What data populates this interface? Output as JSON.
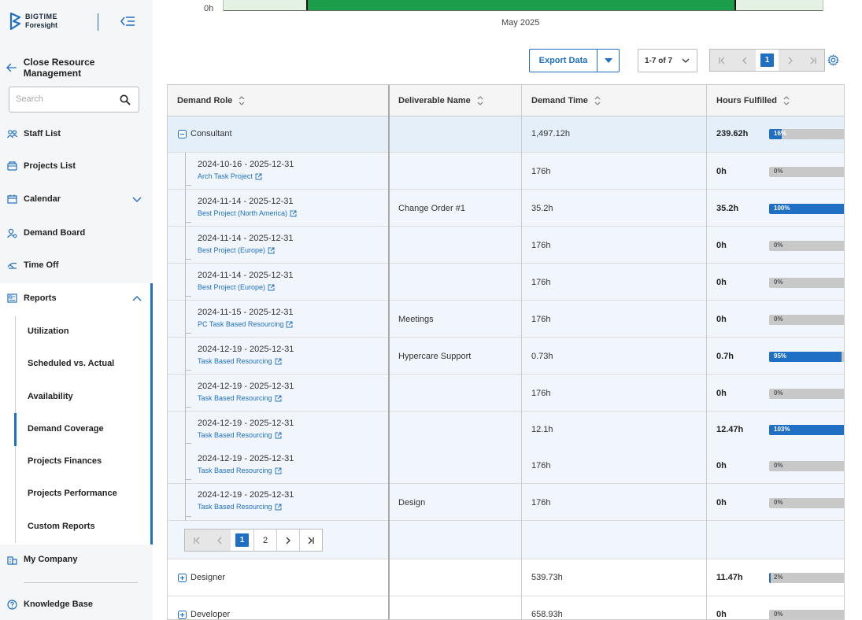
{
  "logo": {
    "line1": "BIGTIME",
    "line2": "Foresight"
  },
  "sidebar": {
    "close_label": "Close Resource Management",
    "search_placeholder": "Search",
    "items": [
      {
        "label": "Staff List",
        "icon": "users-icon"
      },
      {
        "label": "Projects List",
        "icon": "folder-icon"
      },
      {
        "label": "Calendar",
        "icon": "calendar-icon"
      },
      {
        "label": "Demand Board",
        "icon": "person-search-icon"
      },
      {
        "label": "Time Off",
        "icon": "plane-icon"
      },
      {
        "label": "Reports",
        "icon": "report-icon"
      },
      {
        "label": "My Company",
        "icon": "building-icon"
      },
      {
        "label": "Knowledge Base",
        "icon": "help-icon"
      }
    ],
    "report_items": [
      "Utilization",
      "Scheduled vs. Actual",
      "Availability",
      "Demand Coverage",
      "Projects Finances",
      "Projects Performance",
      "Custom Reports"
    ],
    "active_report": "Demand Coverage"
  },
  "chart": {
    "zero_label": "0h",
    "month_label": "May 2025",
    "bar_color": "#1a9e4a"
  },
  "toolbar": {
    "export_label": "Export Data",
    "page_size_label": "1-7 of 7",
    "current_page": "1"
  },
  "table": {
    "headers": [
      "Demand Role",
      "Deliverable Name",
      "Demand Time",
      "Hours Fulfilled"
    ],
    "group": {
      "role": "Consultant",
      "demand": "1,497.12h",
      "fulfilled": "239.62h",
      "pct_label": "16%",
      "pct": 16
    },
    "rows": [
      {
        "dates": "2024-10-16 - 2025-12-31",
        "project": "Arch Task Project",
        "deliverable": "",
        "demand": "176h",
        "fulfilled": "0h",
        "pct_label": "0%",
        "pct": 0
      },
      {
        "dates": "2024-11-14 - 2025-12-31",
        "project": "Best Project (North America)",
        "deliverable": "Change Order #1",
        "demand": "35.2h",
        "fulfilled": "35.2h",
        "pct_label": "100%",
        "pct": 100
      },
      {
        "dates": "2024-11-14 - 2025-12-31",
        "project": "Best Project (Europe)",
        "deliverable": "",
        "demand": "176h",
        "fulfilled": "0h",
        "pct_label": "0%",
        "pct": 0
      },
      {
        "dates": "2024-11-14 - 2025-12-31",
        "project": "Best Project (Europe)",
        "deliverable": "",
        "demand": "176h",
        "fulfilled": "0h",
        "pct_label": "0%",
        "pct": 0
      },
      {
        "dates": "2024-11-15 - 2025-12-31",
        "project": "PC Task Based Resourcing",
        "deliverable": "Meetings",
        "demand": "176h",
        "fulfilled": "0h",
        "pct_label": "0%",
        "pct": 0
      },
      {
        "dates": "2024-12-19 - 2025-12-31",
        "project": "Task Based Resourcing",
        "deliverable": "Hypercare Support",
        "demand": "0.73h",
        "fulfilled": "0.7h",
        "pct_label": "95%",
        "pct": 95
      },
      {
        "dates": "2024-12-19 - 2025-12-31",
        "project": "Task Based Resourcing",
        "deliverable": "",
        "demand": "176h",
        "fulfilled": "0h",
        "pct_label": "0%",
        "pct": 0
      },
      {
        "dates": "2024-12-19 - 2025-12-31",
        "project": "Task Based Resourcing",
        "deliverable": "",
        "demand": "12.1h",
        "fulfilled": "12.47h",
        "pct_label": "103%",
        "pct": 100
      },
      {
        "dates": "2024-12-19 - 2025-12-31",
        "project": "Task Based Resourcing",
        "deliverable": "",
        "demand": "176h",
        "fulfilled": "0h",
        "pct_label": "0%",
        "pct": 0
      },
      {
        "dates": "2024-12-19 - 2025-12-31",
        "project": "Task Based Resourcing",
        "deliverable": "Design",
        "demand": "176h",
        "fulfilled": "0h",
        "pct_label": "0%",
        "pct": 0
      }
    ],
    "inner_pager": {
      "page1": "1",
      "page2": "2"
    },
    "other_groups": [
      {
        "role": "Designer",
        "demand": "539.73h",
        "fulfilled": "11.47h",
        "pct_label": "2%",
        "pct": 2
      },
      {
        "role": "Developer",
        "demand": "658.93h",
        "fulfilled": "0h",
        "pct_label": "0%",
        "pct": 0
      }
    ]
  },
  "colors": {
    "accent": "#1f6fc5",
    "progress_bg": "#c8c8c8"
  }
}
